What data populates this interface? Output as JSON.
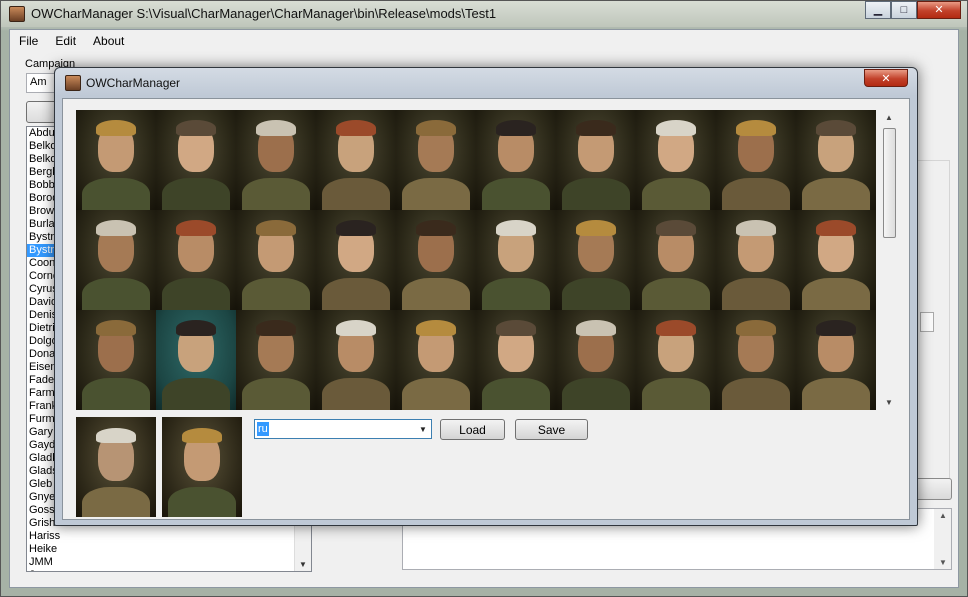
{
  "main_window": {
    "title": "OWCharManager S:\\Visual\\CharManager\\CharManager\\bin\\Release\\mods\\Test1",
    "controls": {
      "minimize": "▁",
      "maximize": "□",
      "close": "✕"
    }
  },
  "menu": {
    "items": [
      "File",
      "Edit",
      "About"
    ]
  },
  "campaign": {
    "label": "Campaign",
    "value": "Am"
  },
  "character_list": {
    "selected_index": 9,
    "items": [
      "Abdul",
      "Belko",
      "Belko",
      "Bergk",
      "Bobby",
      "Borod",
      "Brown",
      "Burlak",
      "Bystro",
      "Bystro",
      "Coonl",
      "Corne",
      "Cyrus",
      "David",
      "Denis",
      "Dietric",
      "Dolgo",
      "Donal",
      "Eisens",
      "Fadee",
      "Farme",
      "Frank",
      "Furma",
      "Gary",
      "Gayda",
      "Gladk",
      "Glads",
      "Gleb",
      "Gnyev",
      "Gossu",
      "Grishk",
      "Hariss",
      "Heike",
      "JMM",
      "Joan"
    ]
  },
  "dialog": {
    "title": "OWCharManager",
    "close": "✕",
    "language_value": "ru",
    "load_label": "Load",
    "save_label": "Save"
  },
  "colors": {
    "accent": "#3399ff",
    "skin_light": "#c49a74",
    "skin_mid": "#a57a55",
    "skin_dark": "#8a5d3e",
    "uniform_green": "#4a5230",
    "uniform_khaki": "#7a6a44"
  },
  "icons": {
    "app": "owcharmanager-app-icon",
    "dropdown": "chevron-down-icon",
    "scroll_up": "scroll-up-icon",
    "scroll_down": "scroll-down-icon"
  }
}
